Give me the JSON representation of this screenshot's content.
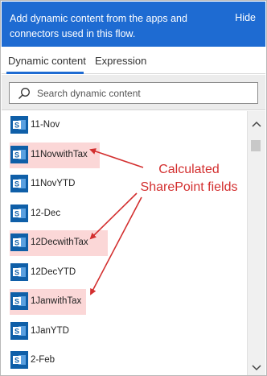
{
  "header": {
    "text": "Add dynamic content from the apps and connectors used in this flow.",
    "hide_label": "Hide"
  },
  "tabs": [
    {
      "label": "Dynamic content",
      "selected": true
    },
    {
      "label": "Expression",
      "selected": false
    }
  ],
  "search": {
    "placeholder": "Search dynamic content",
    "value": ""
  },
  "items": [
    {
      "label": "11-Nov",
      "highlighted": false,
      "icon": "sharepoint-icon"
    },
    {
      "label": "11NovwithTax",
      "highlighted": true,
      "icon": "sharepoint-icon"
    },
    {
      "label": "11NovYTD",
      "highlighted": false,
      "icon": "sharepoint-icon"
    },
    {
      "label": "12-Dec",
      "highlighted": false,
      "icon": "sharepoint-icon"
    },
    {
      "label": "12DecwithTax",
      "highlighted": true,
      "icon": "sharepoint-icon"
    },
    {
      "label": "12DecYTD",
      "highlighted": false,
      "icon": "sharepoint-icon"
    },
    {
      "label": "1JanwithTax",
      "highlighted": true,
      "icon": "sharepoint-icon"
    },
    {
      "label": "1JanYTD",
      "highlighted": false,
      "icon": "sharepoint-icon"
    },
    {
      "label": "2-Feb",
      "highlighted": false,
      "icon": "sharepoint-icon"
    }
  ],
  "annotation": {
    "line1": "Calculated",
    "line2": "SharePoint fields",
    "color": "#d32f2f"
  },
  "colors": {
    "header_bg": "#1e6bd2",
    "highlight_bg": "#fbd7d7",
    "sharepoint_blue": "#0f5fa8"
  }
}
